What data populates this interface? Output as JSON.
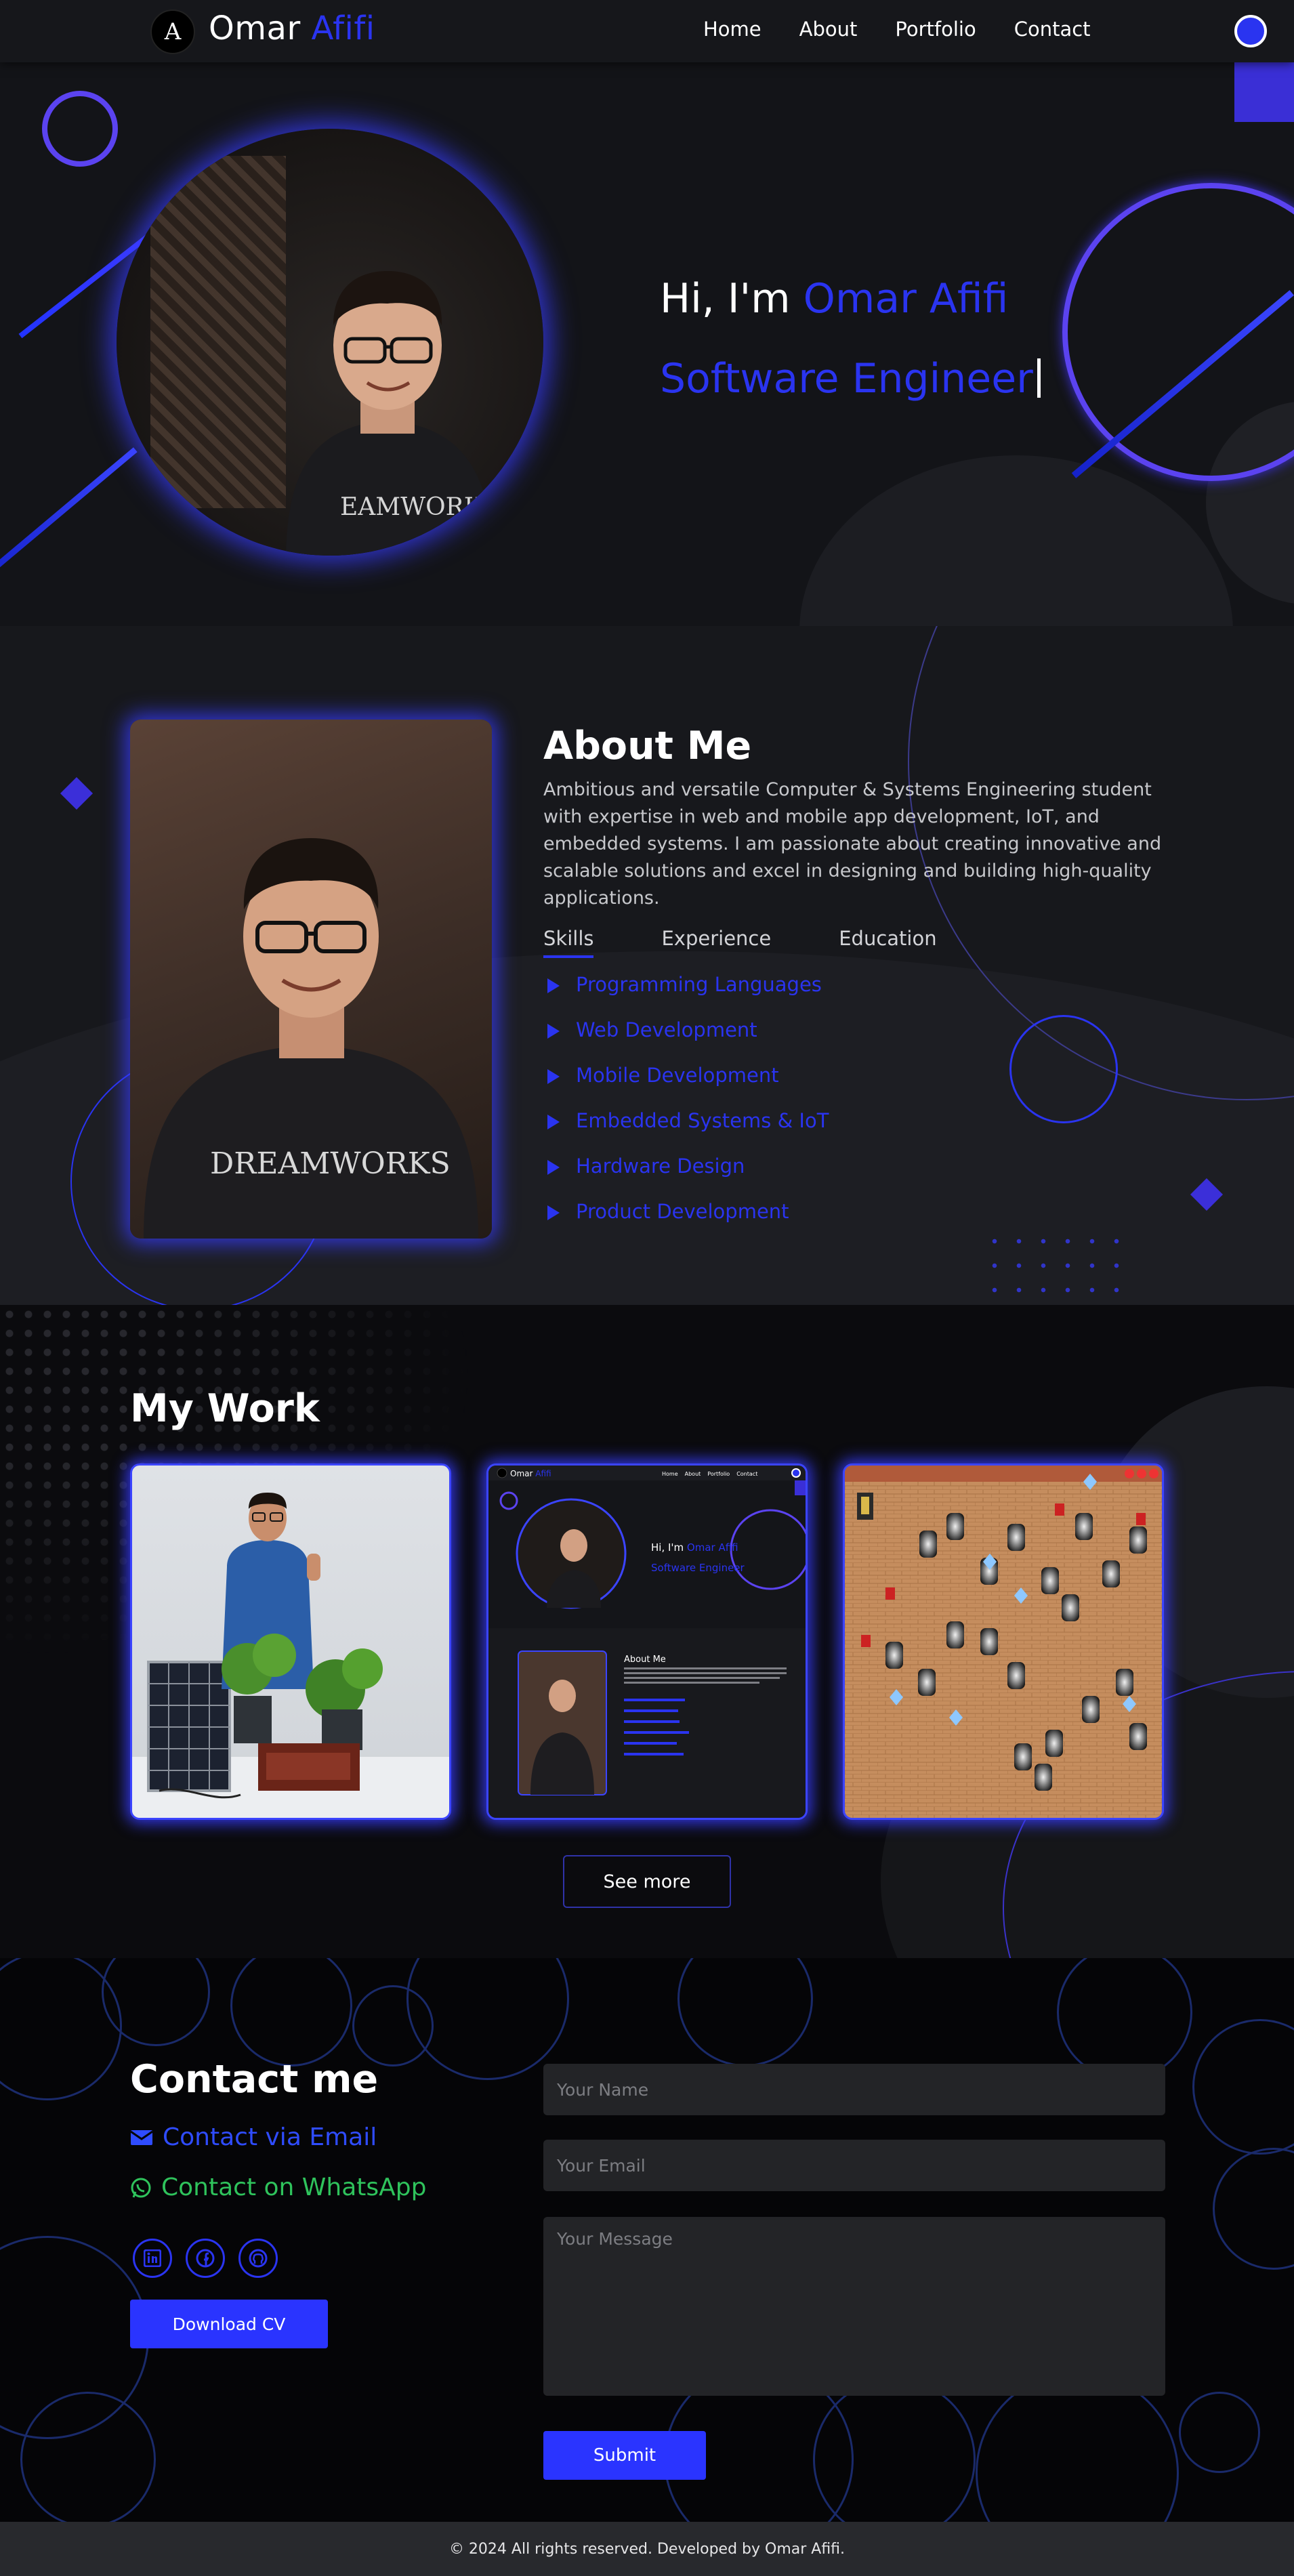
{
  "nav": {
    "logo_text": "A",
    "brand_first": "Omar ",
    "brand_accent": "Afifi",
    "links": [
      "Home",
      "About",
      "Portfolio",
      "Contact"
    ]
  },
  "hero": {
    "greeting": "Hi, I'm ",
    "name": "Omar Afifi",
    "role": "Software Engineer"
  },
  "about": {
    "heading": "About Me",
    "paragraph": "Ambitious and versatile Computer & Systems Engineering student with expertise in web and mobile app development, IoT, and embedded systems. I am passionate about creating innovative and scalable solutions and excel in designing and building high-quality applications.",
    "tabs": [
      "Skills",
      "Experience",
      "Education"
    ],
    "active_tab": "Skills",
    "skills": [
      "Programming Languages",
      "Web Development",
      "Mobile Development",
      "Embedded Systems & IoT",
      "Hardware Design",
      "Product Development"
    ],
    "photo_shirt_text": "DREAMWORKS"
  },
  "work": {
    "heading": "My Work",
    "see_more": "See more",
    "preview": {
      "brand_first": "Omar ",
      "brand_accent": "Afifi",
      "links": [
        "Home",
        "About",
        "Portfolio",
        "Contact"
      ],
      "greeting": "Hi, I'm ",
      "name": "Omar Afifi",
      "role": "Software Engineer",
      "about_heading": "About Me"
    }
  },
  "contact": {
    "heading": "Contact me",
    "email_label": "Contact via Email",
    "whatsapp_label": "Contact on WhatsApp",
    "download_cv": "Download CV",
    "name_placeholder": "Your Name",
    "email_placeholder": "Your Email",
    "message_placeholder": "Your Message",
    "submit": "Submit",
    "social_icons": [
      "linkedin-icon",
      "facebook-icon",
      "github-icon"
    ]
  },
  "footer": {
    "text": "© 2024 All rights reserved. Developed by Omar Afifi."
  },
  "colors": {
    "accent": "#2a34f0",
    "glow": "#3b44ff",
    "whatsapp": "#2fc35c",
    "background": "#0e0f12"
  }
}
